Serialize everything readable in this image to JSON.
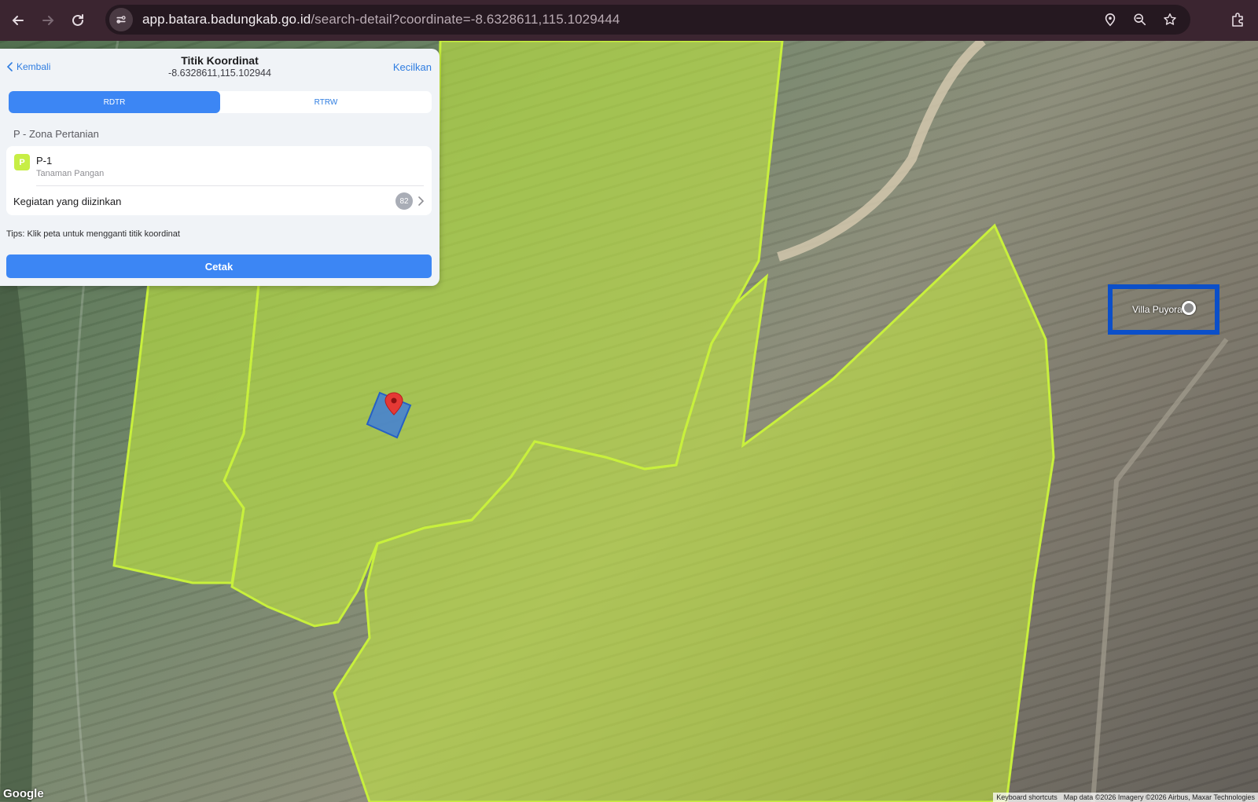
{
  "browser": {
    "url_host": "app.batara.badungkab.go.id",
    "url_path": "/search-detail?coordinate=-8.6328611,115.1029444"
  },
  "panel": {
    "back_label": "Kembali",
    "title": "Titik Koordinat",
    "coordinate": "-8.6328611,115.102944",
    "minimize_label": "Kecilkan",
    "tabs": [
      {
        "label": "RDTR",
        "active": true
      },
      {
        "label": "RTRW",
        "active": false
      }
    ],
    "zone_section": "P - Zona Pertanian",
    "zone": {
      "badge": "P",
      "badge_color": "#c7ee45",
      "code": "P-1",
      "description": "Tanaman Pangan"
    },
    "activities": {
      "label": "Kegiatan yang diizinkan",
      "count": "82"
    },
    "tips": "Tips: Klik peta untuk mengganti titik koordinat",
    "print_label": "Cetak"
  },
  "map": {
    "place_label": "Villa Puyora",
    "zone_fill_color": "#c8f03c",
    "parcel_color": "#3b7ae0",
    "marker_color": "#e53935",
    "logo": "Google",
    "attribution": {
      "shortcuts": "Keyboard shortcuts",
      "data": "Map data ©2026 Imagery ©2026 Airbus, Maxar Technologies"
    }
  }
}
